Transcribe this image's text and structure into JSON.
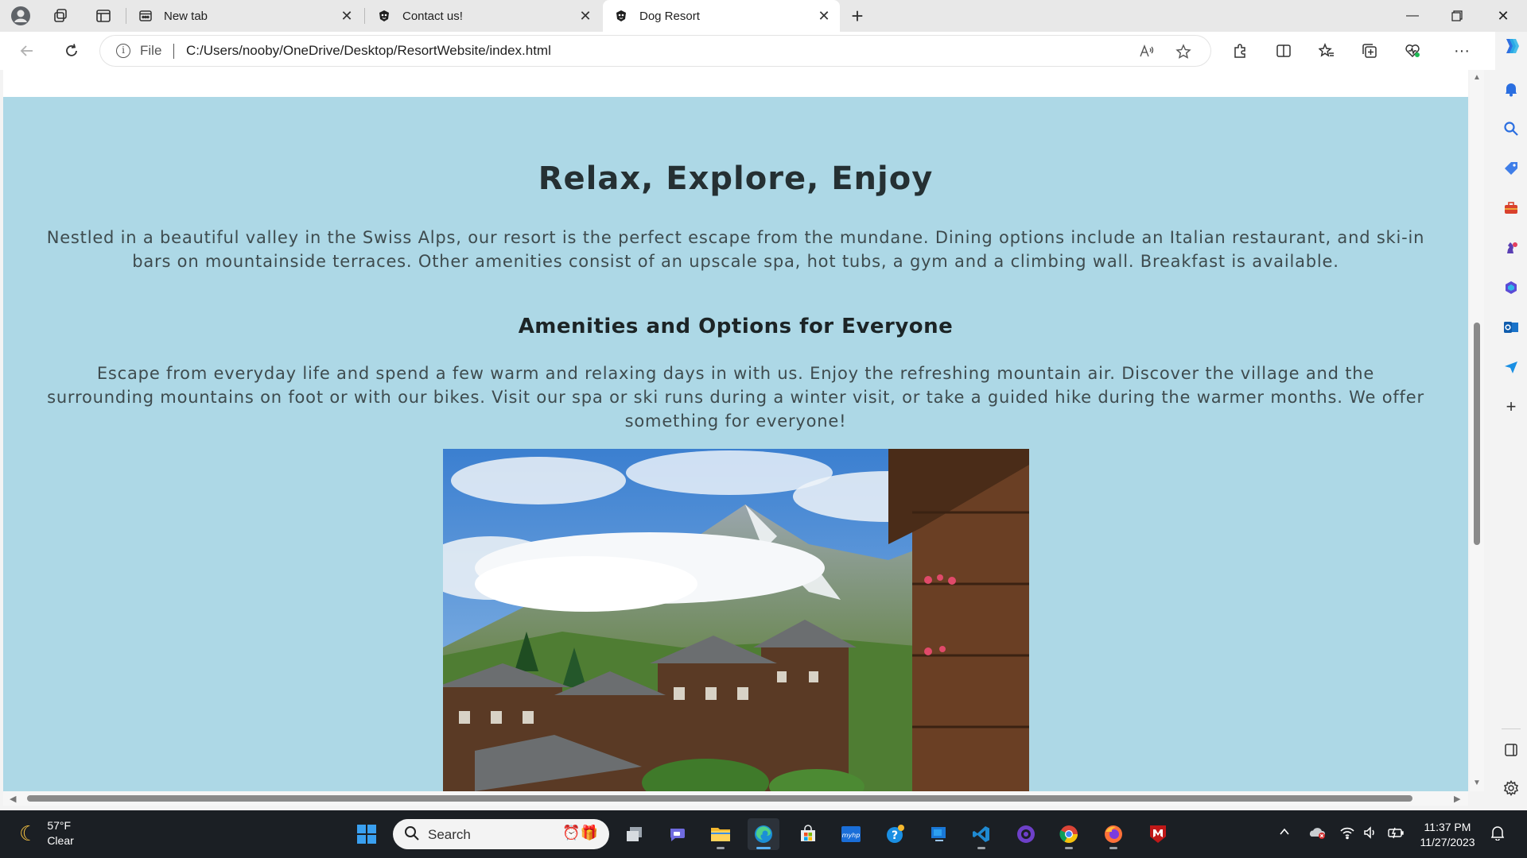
{
  "browser": {
    "tabs": [
      {
        "label": "New tab",
        "favicon": "newtab-icon"
      },
      {
        "label": "Contact us!",
        "favicon": "paw-icon"
      },
      {
        "label": "Dog Resort",
        "favicon": "paw-icon",
        "active": true
      }
    ],
    "address": {
      "scheme_label": "File",
      "url": "C:/Users/nooby/OneDrive/Desktop/ResortWebsite/index.html"
    }
  },
  "page": {
    "background_color": "#add8e6",
    "heading": "Relax, Explore, Enjoy",
    "intro": "Nestled in a beautiful valley in the Swiss Alps, our resort is the perfect escape from the mundane. Dining options include an Italian restaurant, and ski-in bars on mountainside terraces. Other amenities consist of an upscale spa, hot tubs, a gym and a climbing wall. Breakfast is available.",
    "subheading": "Amenities and Options for Everyone",
    "body": "Escape from everyday life and spend a few warm and relaxing days in with us. Enjoy the refreshing mountain air. Discover the village and the surrounding mountains on foot or with our bikes. Visit our spa or ski runs during a winter visit, or take a guided hike during the warmer months. We offer something for everyone!",
    "image_subject": "alpine-village-photo"
  },
  "taskbar": {
    "weather": {
      "temp": "57°F",
      "condition": "Clear"
    },
    "search_label": "Search",
    "clock": {
      "time": "11:37 PM",
      "date": "11/27/2023"
    }
  }
}
